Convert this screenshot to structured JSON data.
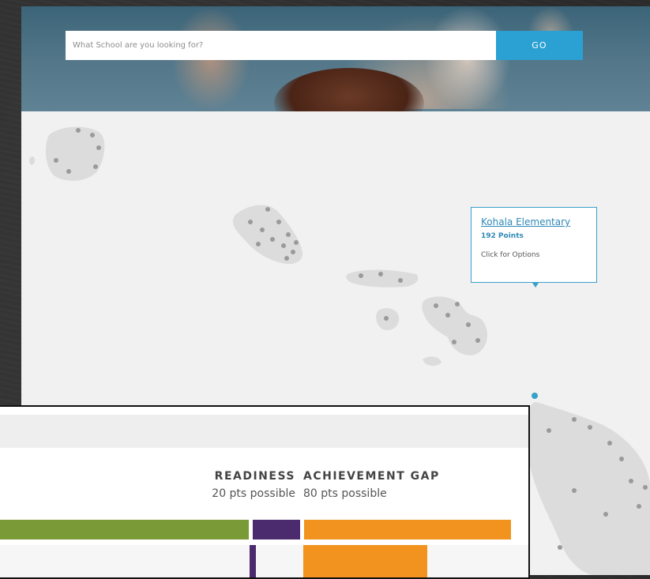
{
  "search": {
    "placeholder": "What School are you looking for?",
    "value": "",
    "go_label": "GO"
  },
  "map": {
    "tooltip": {
      "school_name": "Kohala Elementary",
      "points": "192 Points",
      "options_label": "Click for Options"
    }
  },
  "score_panel": {
    "columns": [
      {
        "title": "READINESS",
        "subtitle": "20 pts possible"
      },
      {
        "title": "ACHIEVEMENT GAP",
        "subtitle": "80 pts possible"
      }
    ]
  },
  "colors": {
    "go_button": "#2aa1d2",
    "tooltip_border": "#3aa0c9",
    "bar_green": "#7a9a38",
    "bar_purple": "#4b2b6e",
    "bar_orange": "#f29320"
  },
  "icons": {
    "map_pin": "map-pin-icon"
  }
}
